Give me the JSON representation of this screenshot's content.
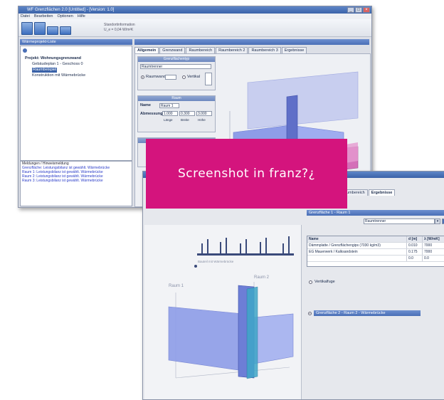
{
  "banner": {
    "text": "Screenshot in franz?¿"
  },
  "back_window": {
    "title": "WF Grenzflächen 2.0 [Untitled] - [Version: 1.0]",
    "menu": [
      "Datei",
      "Bearbeiten",
      "Optionen",
      "Hilfe"
    ],
    "toolbar_text": [
      "Standortinformation",
      "U_e = 0,04 W/m²K"
    ],
    "project_panel_title": "Wärmeprojekt-Liste",
    "tree_items": [
      {
        "label": "Projekt: Wohnungsgrenzwand",
        "selected": false
      },
      {
        "label": "Gebäudeplan 1 - Geschoss 0",
        "selected": false
      },
      {
        "label": "Raumbeispiel",
        "selected": true
      },
      {
        "label": "Konstruktion mit Wärmebrücke",
        "selected": false
      }
    ],
    "log_lines": [
      "Meldungen / Hinweismeldung",
      "Grenzfläche: Leistungsbilanz ist gewählt. Wärmebrücke",
      "Raum 1: Leistungsbilanz ist gewählt. Wärmebrücke",
      "Raum 2: Leistungsbilanz ist gewählt. Wärmebrücke",
      "Raum 3: Leistungsbilanz ist gewählt. Wärmebrücke"
    ],
    "tabs": [
      "Allgemein",
      "Grenzwand",
      "Raumbereich",
      "Raumbereich 2",
      "Raumbereich 3",
      "Ergebnisse"
    ],
    "group1_title": "Grenzflächentyp",
    "group1_value": "Raumtrenner",
    "radio_labels": [
      "Raumwand",
      "Vertikal"
    ],
    "group2_title": "Raum",
    "name_label": "Name",
    "name_value": "Raum 1",
    "measure_label": "Abmessung",
    "measure_values": [
      "1.000",
      "0.300",
      "3.000"
    ],
    "measure_units": [
      "Länge",
      "Breite",
      "Höhe"
    ]
  },
  "front_window": {
    "tabs": [
      "Raumbereich",
      "Ergebnisse"
    ],
    "section_title": "Grenzfläche 1 - Raum 1",
    "dropdown_value": "Raumtrenner",
    "table_headers": [
      "Name",
      "d [m]",
      "λ [W/mK]"
    ],
    "table_rows": [
      [
        "Dämmplatte / Grenzflächengips (7030 kg/m3)",
        "0.010",
        "7000"
      ],
      [
        "EG Mauerwerk / Kalksandstein",
        "0.175",
        "7000"
      ],
      [
        "",
        "0.0",
        "0.0"
      ]
    ],
    "checkbox_label": "Vertikalfuge",
    "bottom_link": "Grenzfläche 2 - Raum 2 - Wärmebrücke",
    "room_labels": [
      "Raum 1",
      "Raum 2"
    ],
    "graph_caption": "Bauteil mit Wärmebrücke"
  },
  "colors": {
    "banner": "#d4147d",
    "window_bg": "#dcdfe6",
    "titlebar": "#3a62a8",
    "wall_blue": "#8e9de8",
    "wall_pink": "#d46fb8"
  }
}
